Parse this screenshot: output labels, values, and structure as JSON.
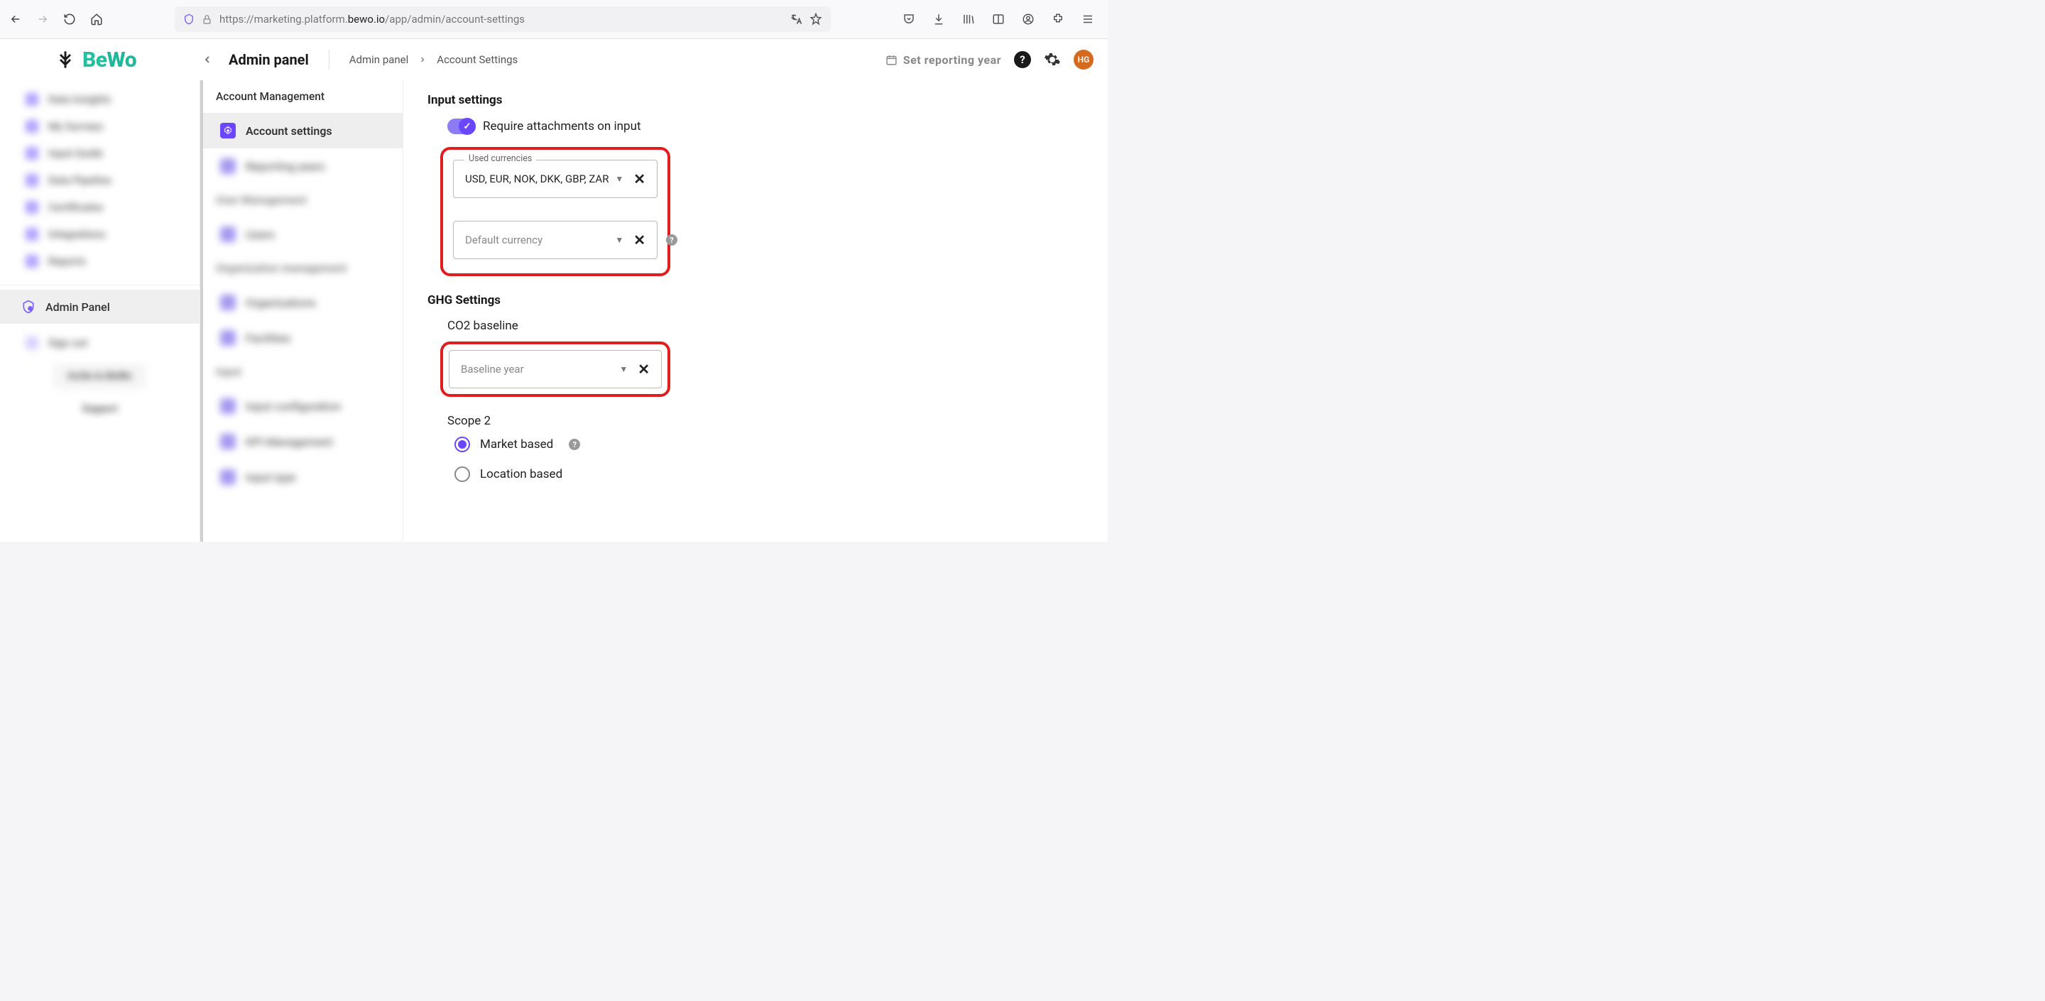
{
  "browser": {
    "url_prefix": "https://marketing.platform.",
    "url_domain": "bewo.io",
    "url_path": "/app/admin/account-settings"
  },
  "logo": {
    "part1": "Be",
    "part2": "Wo"
  },
  "header": {
    "title": "Admin panel",
    "breadcrumb1": "Admin panel",
    "breadcrumb2": "Account Settings",
    "reporting_year": "Set reporting year",
    "avatar_initials": "HG"
  },
  "left_nav": {
    "blurred_top": [
      "Data Insights",
      "My Surveys",
      "Input Guide",
      "Data Pipeline",
      "Certificates",
      "Integrations",
      "Reports"
    ],
    "admin_panel": "Admin Panel",
    "sign_out": "Sign out",
    "invite": "Invite to BeWo",
    "support": "Support"
  },
  "second_nav": {
    "heading1": "Account Management",
    "account_settings": "Account settings",
    "reporting_years": "Reporting years",
    "heading2": "User Management",
    "users": "Users",
    "heading3": "Organization management",
    "organizations": "Organizations",
    "facilities": "Facilities",
    "heading4": "Input",
    "input_config": "Input configuration",
    "kpi_mgmt": "KPI Management",
    "input_type": "Input type"
  },
  "main": {
    "input_settings_title": "Input settings",
    "require_attachments": "Require attachments on input",
    "used_currencies_label": "Used currencies",
    "used_currencies_value": "USD, EUR, NOK, DKK, GBP, ZAR",
    "default_currency_placeholder": "Default currency",
    "ghg_settings_title": "GHG Settings",
    "co2_baseline_title": "CO2 baseline",
    "baseline_year_placeholder": "Baseline year",
    "scope2_title": "Scope 2",
    "market_based": "Market based",
    "location_based": "Location based"
  }
}
